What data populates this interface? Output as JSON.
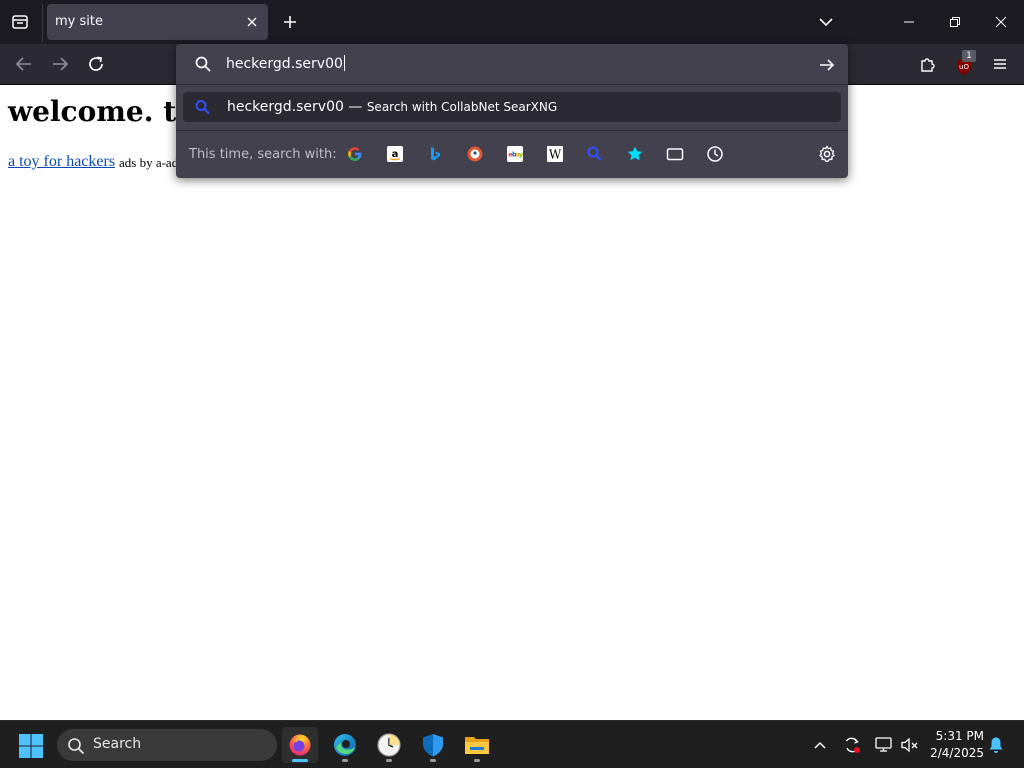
{
  "browser": {
    "tab": {
      "title": "my site"
    },
    "urlbar": {
      "value": "heckergd.serv00",
      "suggestion": {
        "text": "heckergd.serv00",
        "separator": "—",
        "action": "Search with CollabNet SearXNG"
      },
      "search_with_label": "This time, search with:",
      "engines": [
        {
          "name": "Google",
          "icon": "google-icon"
        },
        {
          "name": "Amazon",
          "icon": "amazon-icon"
        },
        {
          "name": "Bing",
          "icon": "bing-icon"
        },
        {
          "name": "DuckDuckGo",
          "icon": "duckduckgo-icon"
        },
        {
          "name": "eBay",
          "icon": "ebay-icon"
        },
        {
          "name": "Wikipedia",
          "icon": "wikipedia-icon"
        },
        {
          "name": "CollabNet SearXNG",
          "icon": "searxng-icon"
        },
        {
          "name": "Bookmarks",
          "icon": "star-icon"
        },
        {
          "name": "Tabs",
          "icon": "tabs-icon"
        },
        {
          "name": "History",
          "icon": "history-icon"
        }
      ]
    },
    "extension_badge": "1"
  },
  "page": {
    "heading": "welcome. thi",
    "link": "a toy for hackers",
    "ads_text": "ads by a-ad"
  },
  "taskbar": {
    "search_placeholder": "Search",
    "apps": [
      "firefox-icon",
      "edge-icon",
      "clock-app-icon",
      "defender-icon",
      "file-explorer-icon"
    ],
    "time": "5:31 PM",
    "date": "2/4/2025"
  },
  "colors": {
    "tabstrip_bg": "#1c1b22",
    "toolbar_bg": "#2b2a33",
    "urlbar_bg": "#42414d",
    "accent_blue": "#4cc2ff",
    "link_color": "#0b4ab3"
  }
}
